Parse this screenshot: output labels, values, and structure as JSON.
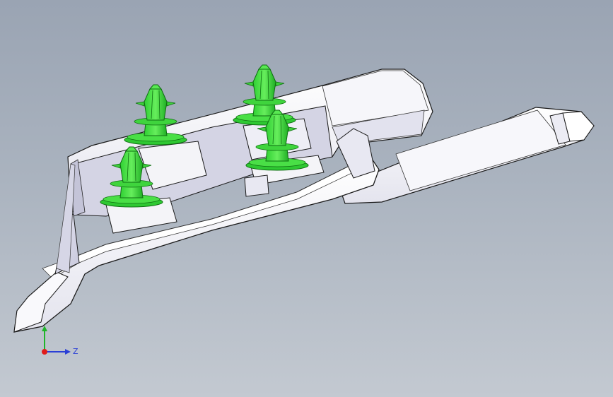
{
  "viewport": {
    "background_top": "#9aa4b3",
    "background_bottom": "#c3c9d1",
    "part_color": "#f2f2f6",
    "part_shade": "#d8d8e6",
    "edge_color": "#1a1a1a",
    "clip_color": "#39d43a",
    "clip_dark": "#17a21c"
  },
  "triad": {
    "x_axis_label": "Z",
    "x_color": "#2a3fd6",
    "y_color": "#1fb52a",
    "origin_color": "#e01b1b"
  }
}
